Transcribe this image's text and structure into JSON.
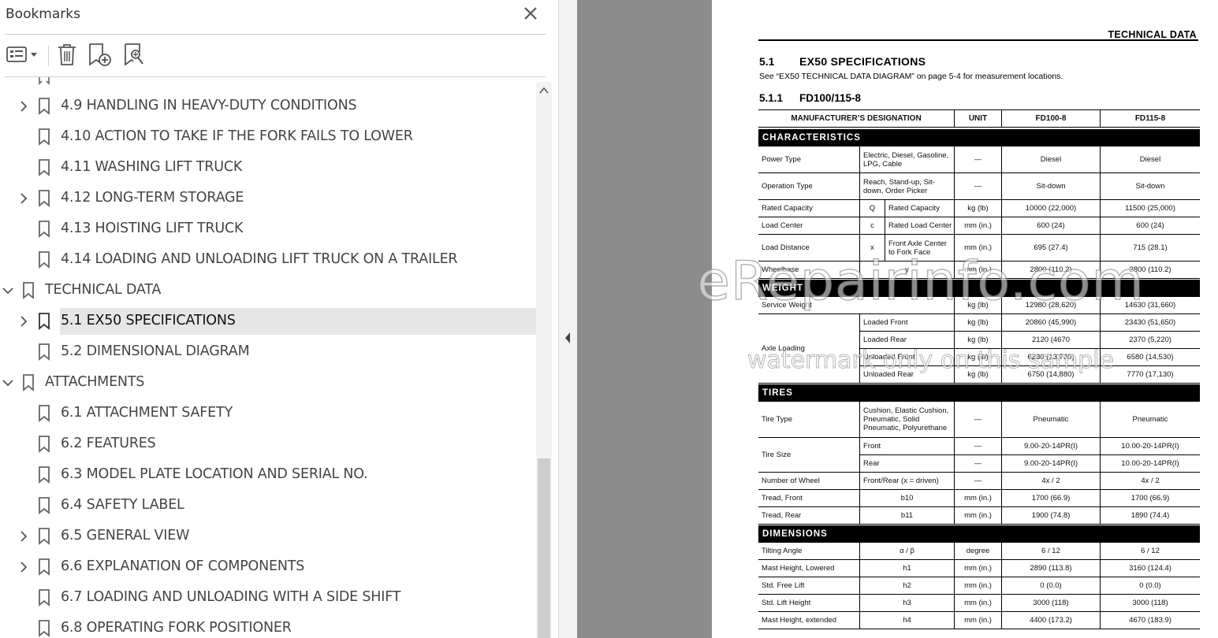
{
  "bookmarks_panel": {
    "title": "Bookmarks",
    "toolbar": {
      "options_icon": "list-options-icon",
      "delete_icon": "trash-icon",
      "new_bookmark_icon": "bookmark-add-icon",
      "find_bookmark_icon": "bookmark-search-icon"
    },
    "items": [
      {
        "label": "4.9 HANDLING IN HEAVY-DUTY CONDITIONS",
        "level": 2,
        "expandable": true,
        "expanded": false,
        "selected": false
      },
      {
        "label": "4.10 ACTION TO TAKE IF THE FORK FAILS TO LOWER",
        "level": 2,
        "expandable": false,
        "expanded": false,
        "selected": false
      },
      {
        "label": "4.11 WASHING LIFT TRUCK",
        "level": 2,
        "expandable": false,
        "expanded": false,
        "selected": false
      },
      {
        "label": "4.12 LONG-TERM STORAGE",
        "level": 2,
        "expandable": true,
        "expanded": false,
        "selected": false
      },
      {
        "label": "4.13 HOISTING LIFT TRUCK",
        "level": 2,
        "expandable": false,
        "expanded": false,
        "selected": false
      },
      {
        "label": "4.14 LOADING AND UNLOADING LIFT TRUCK ON A TRAILER",
        "level": 2,
        "expandable": false,
        "expanded": false,
        "selected": false
      },
      {
        "label": "TECHNICAL DATA",
        "level": 1,
        "expandable": true,
        "expanded": true,
        "selected": false
      },
      {
        "label": "5.1 EX50 SPECIFICATIONS",
        "level": 2,
        "expandable": true,
        "expanded": false,
        "selected": true
      },
      {
        "label": "5.2 DIMENSIONAL DIAGRAM",
        "level": 2,
        "expandable": false,
        "expanded": false,
        "selected": false
      },
      {
        "label": "ATTACHMENTS",
        "level": 1,
        "expandable": true,
        "expanded": true,
        "selected": false
      },
      {
        "label": "6.1 ATTACHMENT SAFETY",
        "level": 2,
        "expandable": false,
        "expanded": false,
        "selected": false
      },
      {
        "label": "6.2 FEATURES",
        "level": 2,
        "expandable": false,
        "expanded": false,
        "selected": false
      },
      {
        "label": "6.3 MODEL PLATE LOCATION AND SERIAL NO.",
        "level": 2,
        "expandable": false,
        "expanded": false,
        "selected": false
      },
      {
        "label": "6.4 SAFETY LABEL",
        "level": 2,
        "expandable": false,
        "expanded": false,
        "selected": false
      },
      {
        "label": "6.5 GENERAL VIEW",
        "level": 2,
        "expandable": true,
        "expanded": false,
        "selected": false
      },
      {
        "label": "6.6 EXPLANATION OF COMPONENTS",
        "level": 2,
        "expandable": true,
        "expanded": false,
        "selected": false
      },
      {
        "label": "6.7 LOADING AND UNLOADING WITH A SIDE SHIFT",
        "level": 2,
        "expandable": false,
        "expanded": false,
        "selected": false
      },
      {
        "label": "6.8 OPERATING FORK POSITIONER",
        "level": 2,
        "expandable": false,
        "expanded": false,
        "selected": false
      }
    ]
  },
  "document": {
    "header": "TECHNICAL DATA",
    "section_number": "5.1",
    "section_title": "EX50 SPECIFICATIONS",
    "section_note": "See “EX50 TECHNICAL DATA DIAGRAM” on page 5-4 for measurement locations.",
    "subsection_number": "5.1.1",
    "subsection_title": "FD100/115-8",
    "table_header": [
      "MANUFACTURER’S DESIGNATION",
      "UNIT",
      "FD100-8",
      "FD115-8"
    ],
    "sections": {
      "characteristics": "CHARACTERISTICS",
      "weight": "WEIGHT",
      "tires": "TIRES",
      "dimensions": "DIMENSIONS"
    },
    "rows": {
      "power_type": [
        "Power Type",
        "Electric, Diesel, Gasoline, LPG, Cable",
        "—",
        "Diesel",
        "Diesel"
      ],
      "operation_type": [
        "Operation Type",
        "Reach, Stand-up, Sit-down, Order Picker",
        "—",
        "Sit-down",
        "Sit-down"
      ],
      "rated_capacity": [
        "Rated Capacity",
        "Q",
        "Rated Capacity",
        "kg (lb)",
        "10000 (22,000)",
        "11500 (25,000)"
      ],
      "load_center": [
        "Load Center",
        "c",
        "Rated Load Center",
        "mm (in.)",
        "600 (24)",
        "600 (24)"
      ],
      "load_distance": [
        "Load Distance",
        "x",
        "Front Axle Center to Fork Face",
        "mm (in.)",
        "695 (27.4)",
        "715 (28.1)"
      ],
      "wheelbase": [
        "Wheelbase",
        "y",
        "mm (in.)",
        "2800 (110.2)",
        "2800 (110.2)"
      ],
      "service_weight": [
        "Service Weight",
        "kg (lb)",
        "12980 (28,620)",
        "14630 (31,660)"
      ],
      "axle_loading_label": "Axle Loading",
      "axle_rows": [
        [
          "Loaded Front",
          "kg (lb)",
          "20860 (45,990)",
          "23430 (51,650)"
        ],
        [
          "Loaded Rear",
          "kg (lb)",
          "2120 (4670",
          "2370 (5,220)"
        ],
        [
          "Unloaded Front",
          "kg (lb)",
          "6230 (13,730)",
          "6580 (14,530)"
        ],
        [
          "Unloaded Rear",
          "kg (lb)",
          "6750 (14,880)",
          "7770 (17,130)"
        ]
      ],
      "tire_type": [
        "Tire Type",
        "Cushion, Elastic Cushion, Pneumatic, Solid Pneumatic, Polyurethane",
        "—",
        "Pneumatic",
        "Pneumatic"
      ],
      "tire_size_label": "Tire Size",
      "tire_size_rows": [
        [
          "Front",
          "—",
          "9.00-20-14PR(I)",
          "10.00-20-14PR(I)"
        ],
        [
          "Rear",
          "—",
          "9.00-20-14PR(I)",
          "10.00-20-14PR(I)"
        ]
      ],
      "number_of_wheel": [
        "Number of Wheel",
        "Front/Rear (x = driven)",
        "—",
        "4x / 2",
        "4x / 2"
      ],
      "tread_front": [
        "Tread, Front",
        "b10",
        "mm (in.)",
        "1700 (66.9)",
        "1700 (66.9)"
      ],
      "tread_rear": [
        "Tread, Rear",
        "b11",
        "mm (in.)",
        "1900 (74.8)",
        "1890 (74.4)"
      ],
      "dimension_rows": [
        [
          "Tilting Angle",
          "α / β",
          "degree",
          "6 / 12",
          "6 / 12"
        ],
        [
          "Mast Height, Lowered",
          "h1",
          "mm (in.)",
          "2890 (113.8)",
          "3160 (124.4)"
        ],
        [
          "Std. Free Lift",
          "h2",
          "mm (in.)",
          "0 (0.0)",
          "0 (0.0)"
        ],
        [
          "Std. Lift Height",
          "h3",
          "mm (in.)",
          "3000 (118)",
          "3000 (118)"
        ],
        [
          "Mast Height, extended",
          "h4",
          "mm (in.)",
          "4400 (173.2)",
          "4670 (183.9)"
        ]
      ]
    },
    "watermark_main": "eRepairinfo.com",
    "watermark_sub": "watermark only on this sample"
  }
}
